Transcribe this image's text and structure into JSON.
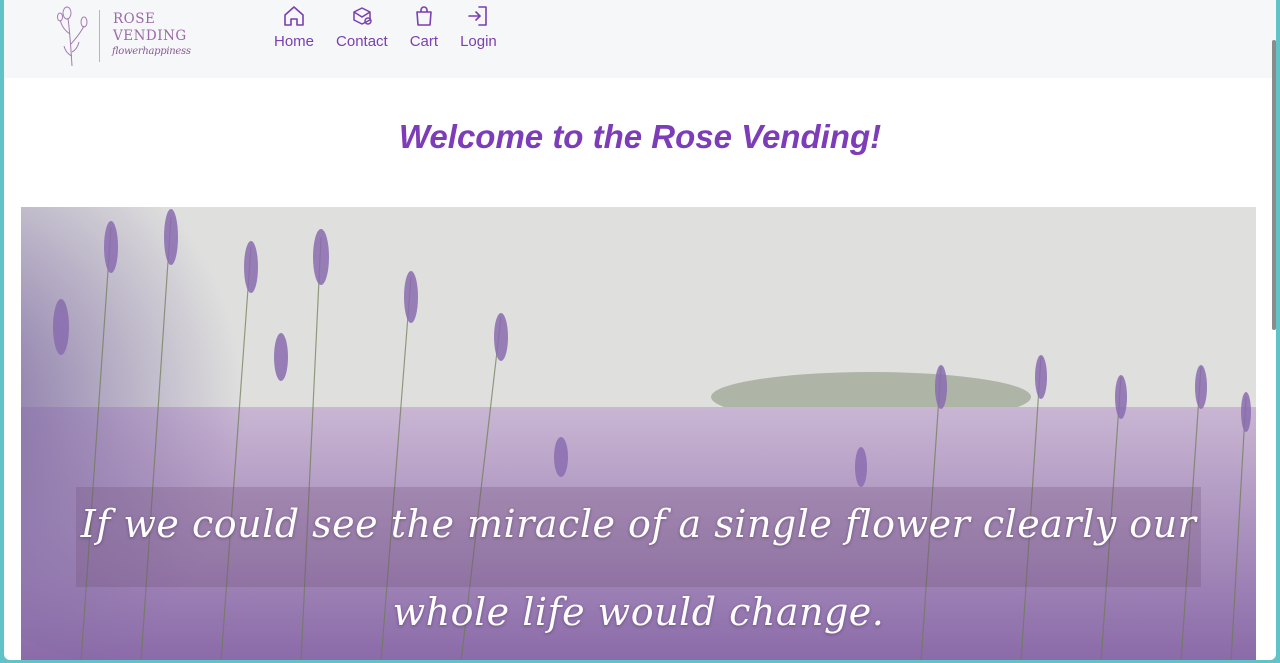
{
  "brand": {
    "line1": "ROSE",
    "line2": "VENDING",
    "tagline": "flowerhappiness"
  },
  "nav": {
    "items": [
      {
        "label": "Home",
        "icon": "home-icon"
      },
      {
        "label": "Contact",
        "icon": "contact-icon"
      },
      {
        "label": "Cart",
        "icon": "cart-icon"
      },
      {
        "label": "Login",
        "icon": "login-icon"
      }
    ]
  },
  "main": {
    "heading": "Welcome to the Rose Vending!",
    "hero_quote_line1": "If we could see the miracle of a single flower clearly our",
    "hero_quote_line2": "whole life would change."
  },
  "colors": {
    "accent": "#7d3cb8",
    "nav_text": "#7a3fb0",
    "navbar_bg": "#f6f7f9",
    "frame_bg": "#5fc3c8"
  }
}
